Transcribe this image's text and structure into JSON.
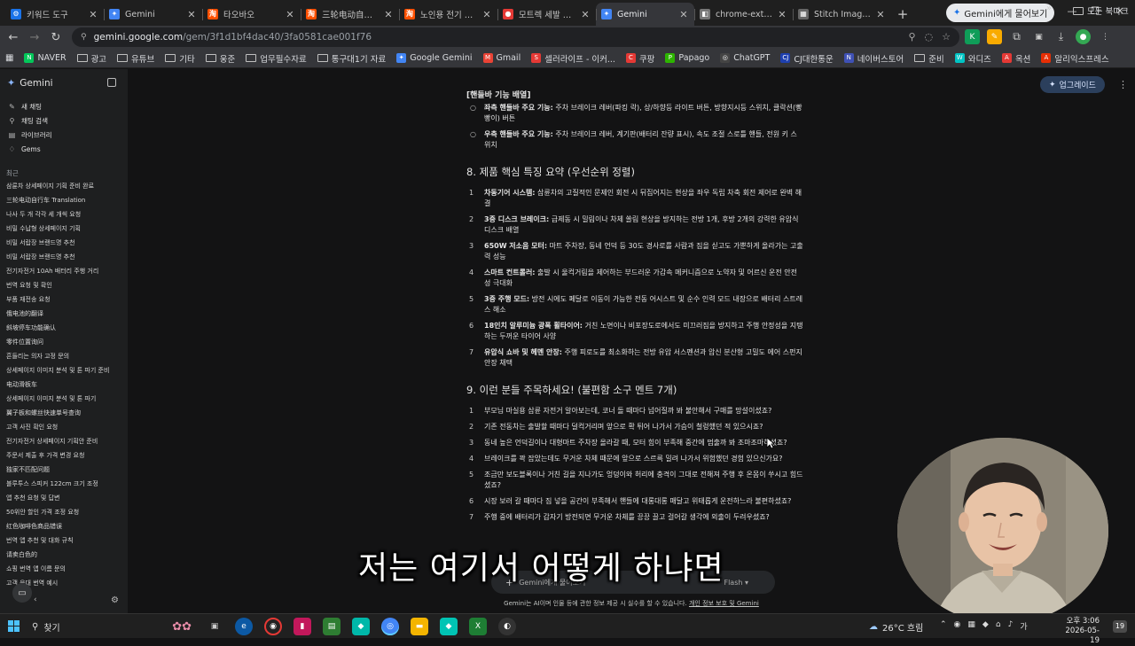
{
  "browser": {
    "tabs": [
      {
        "label": "키워드 도구",
        "icon_color": "#1a73e8",
        "icon_char": "⚙",
        "active": false
      },
      {
        "label": "Gemini",
        "icon_color": "#4285f4",
        "icon_char": "✦",
        "active": false
      },
      {
        "label": "타오바오",
        "icon_color": "#ff5000",
        "icon_char": "淘",
        "active": false
      },
      {
        "label": "三轮电动自行车",
        "icon_color": "#ff5000",
        "icon_char": "淘",
        "active": false
      },
      {
        "label": "노인용 전기 삼륜",
        "icon_color": "#ff5000",
        "icon_char": "淘",
        "active": false
      },
      {
        "label": "모트렉 세발 전기",
        "icon_color": "#e53935",
        "icon_char": "●",
        "active": false
      },
      {
        "label": "Gemini",
        "icon_color": "#4285f4",
        "icon_char": "✦",
        "active": true
      },
      {
        "label": "chrome-extension",
        "icon_color": "#777777",
        "icon_char": "◧",
        "active": false
      },
      {
        "label": "Stitch Images",
        "icon_color": "#666666",
        "icon_char": "▦",
        "active": false
      }
    ],
    "ask_gemini_label": "Gemini에게 물어보기",
    "url_host": "gemini.google.com",
    "url_path": "/gem/3f1d1bf4dac40/3fa0581cae001f76",
    "bookmarks": [
      {
        "label": "NAVER",
        "type": "site",
        "color": "#03c75a",
        "char": "N"
      },
      {
        "label": "광고",
        "type": "folder"
      },
      {
        "label": "유튜브",
        "type": "folder"
      },
      {
        "label": "기타",
        "type": "folder"
      },
      {
        "label": "웅준",
        "type": "folder"
      },
      {
        "label": "업무필수자료",
        "type": "folder"
      },
      {
        "label": "통구대1기 자료",
        "type": "folder"
      },
      {
        "label": "Google Gemini",
        "type": "site",
        "color": "#4285f4",
        "char": "✦"
      },
      {
        "label": "Gmail",
        "type": "site",
        "color": "#ea4335",
        "char": "M"
      },
      {
        "label": "셀러라이프 - 이커...",
        "type": "site",
        "color": "#e53935",
        "char": "S"
      },
      {
        "label": "쿠팡",
        "type": "site",
        "color": "#e53935",
        "char": "C"
      },
      {
        "label": "Papago",
        "type": "site",
        "color": "#2db400",
        "char": "P"
      },
      {
        "label": "ChatGPT",
        "type": "site",
        "color": "#444444",
        "char": "◎"
      },
      {
        "label": "CJ대한통운",
        "type": "site",
        "color": "#1e40af",
        "char": "CJ"
      },
      {
        "label": "네이버스토어",
        "type": "site",
        "color": "#3f51b5",
        "char": "N"
      },
      {
        "label": "준비",
        "type": "folder"
      },
      {
        "label": "와디즈",
        "type": "site",
        "color": "#00c4c4",
        "char": "W"
      },
      {
        "label": "옥션",
        "type": "site",
        "color": "#e53935",
        "char": "A"
      },
      {
        "label": "알리익스프레스",
        "type": "site",
        "color": "#e62e04",
        "char": "A"
      }
    ],
    "all_bookmarks_label": "모든 북마크"
  },
  "sidebar": {
    "brand": "Gemini",
    "nav": [
      {
        "label": "새 채팅",
        "icon": "edit-icon"
      },
      {
        "label": "채팅 검색",
        "icon": "search-icon"
      },
      {
        "label": "라이브러리",
        "icon": "library-icon"
      },
      {
        "label": "Gems",
        "icon": "gems-icon"
      }
    ],
    "recent_title": "최근",
    "recent": [
      "삼륜차 상세페이지 기획 준비 완료",
      "三轮电动自行车 Translation",
      "나사 두 개 각각 세 개씩 요청",
      "비밀 수납형 상세페이지 기획",
      "비밀 서랍장 브랜드명 추천",
      "비밀 서랍장 브랜드명 추천",
      "전기자전거 10Ah 배터리 주행 거리",
      "번역 요청 및 확인",
      "부품 재전송 요청",
      "俄电池的翻译",
      "斜坡停车功能确认",
      "零件位置询问",
      "흔들리는 의자 고정 문의",
      "상세페이지 이미지 분석 및 톤 파기 준비",
      "电动滑板车",
      "상세페이지 이미지 분석 및 톤 파기",
      "翼子板和螺丝快速单号查询",
      "고객 사진 확인 요청",
      "전기자전거 상세페이지 기획안 준비",
      "주문서 제출 후 가격 변경 요청",
      "独家不匹配问题",
      "블루투스 스피커 122cm 크기 조정",
      "앱 추천 요청 및 답변",
      "50위안 할인 가격 조정 요청",
      "红色咖啡色商品错误",
      "번역 앱 추천 및 대화 규칙",
      "请卖白色的",
      "쇼핑 번역 앱 이름 문의",
      "고객 응대 번역 예시"
    ]
  },
  "main": {
    "upgrade_label": "업그레이드",
    "handlebar_heading": "[핸들바 기능 배열]",
    "handlebar_items": [
      {
        "bold": "좌측 핸들바 주요 기능:",
        "text": " 주차 브레이크 레버(파킹 락), 상/하향등 라이트 버튼, 방향지시등 스위치, 클락션(빵빵이) 버튼"
      },
      {
        "bold": "우측 핸들바 주요 기능:",
        "text": " 주차 브레이크 레버, 계기판(배터리 잔량 표시), 속도 조절 스로틀 핸들, 전원 키 스위치"
      }
    ],
    "section8_title": "8. 제품 핵심 특징 요약 (우선순위 정렬)",
    "section8_items": [
      {
        "num": "1",
        "bold": "차동기어 시스템:",
        "text": " 삼륜차의 고질적인 문제인 회전 시 뒤집어지는 현상을 좌우 독립 차축 회전 제어로 완벽 해결"
      },
      {
        "num": "2",
        "bold": "3중 디스크 브레이크:",
        "text": " 급제동 시 밀림이나 차체 쏠림 현상을 방지하는 전방 1개, 후방 2개의 강력한 유압식 디스크 배열"
      },
      {
        "num": "3",
        "bold": "650W 저소음 모터:",
        "text": " 마트 주차장, 동네 언덕 등 30도 경사로를 사람과 짐을 싣고도 가뿐하게 올라가는 고출력 성능"
      },
      {
        "num": "4",
        "bold": "스마트 컨트롤러:",
        "text": " 출발 시 울컥거림을 제어하는 부드러운 가감속 메커니즘으로 노약자 및 어르신 운전 안전성 극대화"
      },
      {
        "num": "5",
        "bold": "3중 주행 모드:",
        "text": " 방전 시에도 페달로 이동이 가능한 전동 어시스트 및 순수 인력 모드 내장으로 배터리 스트레스 해소"
      },
      {
        "num": "6",
        "bold": "18인치 알루미늄 광폭 휠타이어:",
        "text": " 거친 노면이나 비포장도로에서도 미끄러짐을 방지하고 주행 안정성을 지탱하는 두꺼운 타이어 사양"
      },
      {
        "num": "7",
        "bold": "유압식 쇼바 및 헤멘 안장:",
        "text": " 주행 피로도를 최소화하는 전방 유압 서스펜션과 압신 분산형 고밀도 에어 스펀지 안장 채택"
      }
    ],
    "section9_title": "9. 이런 분들 주목하세요! (불편함 소구 멘트 7개)",
    "section9_items": [
      {
        "num": "1",
        "text": "부모님 마실용 삼륜 자전거 알아보는데, 코너 돌 때마다 넘어질까 봐 불안해서 구매를 망설이셨죠?"
      },
      {
        "num": "2",
        "text": "기존 전동차는 출발할 때마다 덜컥거리며 앞으로 확 튀어 나가서 가슴이 철렁했던 적 있으시죠?"
      },
      {
        "num": "3",
        "text": "동네 높은 언덕길이나 대형마트 주차장 올라갈 때, 모터 힘이 부족해 중간에 멈출까 봐 조마조마하셨죠?"
      },
      {
        "num": "4",
        "text": "브레이크를 꽉 잡았는데도 무거운 차체 때문에 앞으로 스르륵 밀려 나가서 위험했던 경험 있으신가요?"
      },
      {
        "num": "5",
        "text": "조금만 보도블록이나 거친 길을 지나가도 엉덩이와 허리에 충격이 그대로 전해져 주행 후 온몸이 쑤시고 힘드셨죠?"
      },
      {
        "num": "6",
        "text": "시장 보러 갈 때마다 짐 넣을 공간이 부족해서 핸들에 대롱대롱 매달고 위태롭게 운전하느라 불편하셨죠?"
      },
      {
        "num": "7",
        "text": "주행 중에 배터리가 갑자기 방전되면 무거운 차체를 끙끙 끌고 걸어갈 생각에 외출이 두려우셨죠?"
      }
    ],
    "input_placeholder": "Gemini에게 물어보기",
    "input_model": "Flash",
    "footer_note": "Gemini는 AI이며 인물 등에 관한 정보 제공 시 실수를 할 수 있습니다.",
    "footer_link": "개인 정보 보호 및 Gemini",
    "subtitle": "저는 여기서 어떻게 하냐면"
  },
  "taskbar": {
    "search_label": "찾기",
    "weather": "26°C 흐림",
    "time": "오후 3:06",
    "date": "2026-05-19",
    "notif_count": "19"
  }
}
